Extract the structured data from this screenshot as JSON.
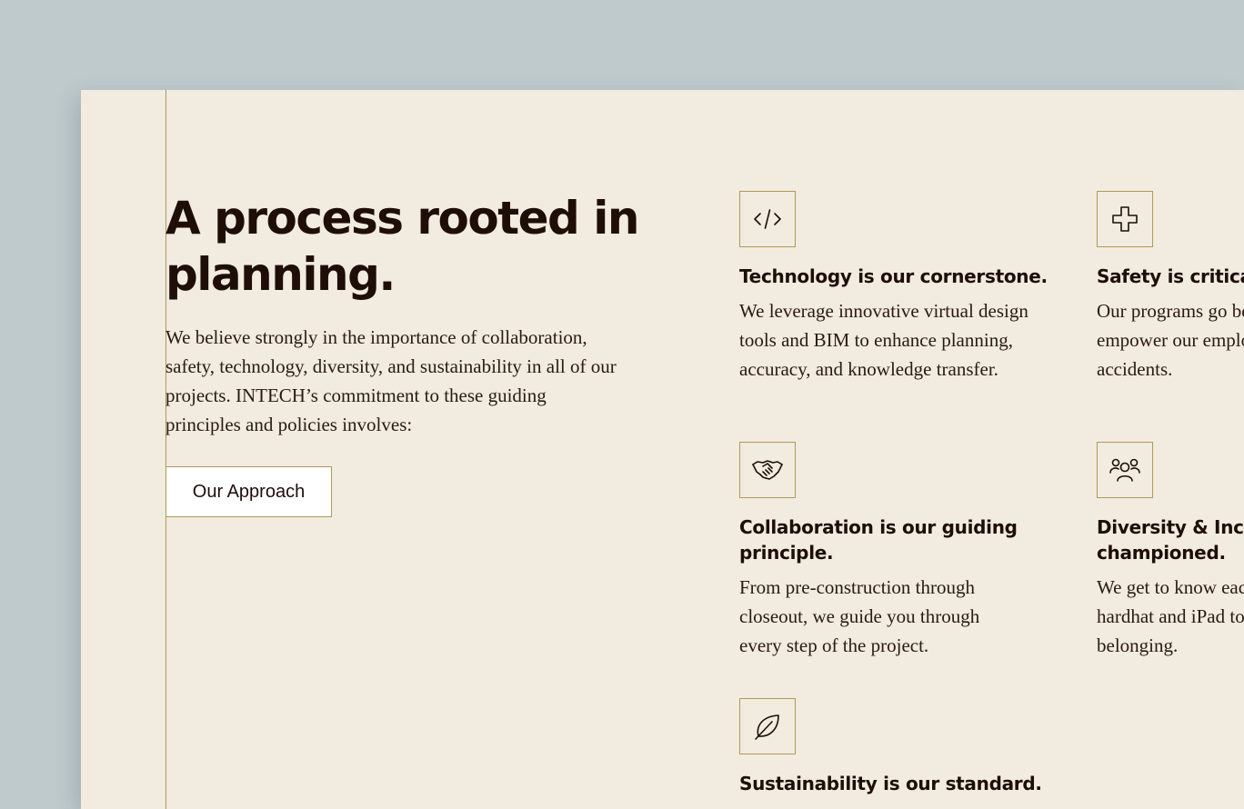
{
  "intro": {
    "headline": "A process rooted in planning.",
    "body": "We believe strongly in the importance of collaboration, safety, technology, diversity, and sustainability in all of our projects. INTECH’s commitment to these guiding principles and policies involves:",
    "button_label": "Our Approach"
  },
  "features": [
    {
      "icon": "code-icon",
      "title": "Technology is our cornerstone.",
      "text": "We leverage innovative virtual design tools and BIM to enhance planning, accuracy, and knowledge transfer."
    },
    {
      "icon": "plus-cross-icon",
      "title": "Safety is critical.",
      "text": "Our programs go beyond compliance to empower our employees and prevent accidents."
    },
    {
      "icon": "handshake-icon",
      "title": "Collaboration is our guiding principle.",
      "text": "From pre-construction through closeout, we guide you through every step of the project."
    },
    {
      "icon": "people-group-icon",
      "title": "Diversity & Inclusion is championed.",
      "text": "We get to know each other beyond the hardhat and iPad to foster a sense of belonging."
    },
    {
      "icon": "leaf-icon",
      "title": "Sustainability is our standard.",
      "text": ""
    }
  ],
  "colors": {
    "background": "#bfcacd",
    "page": "#f1ebe0",
    "accent": "#b09a55",
    "text": "#1e0e07"
  }
}
